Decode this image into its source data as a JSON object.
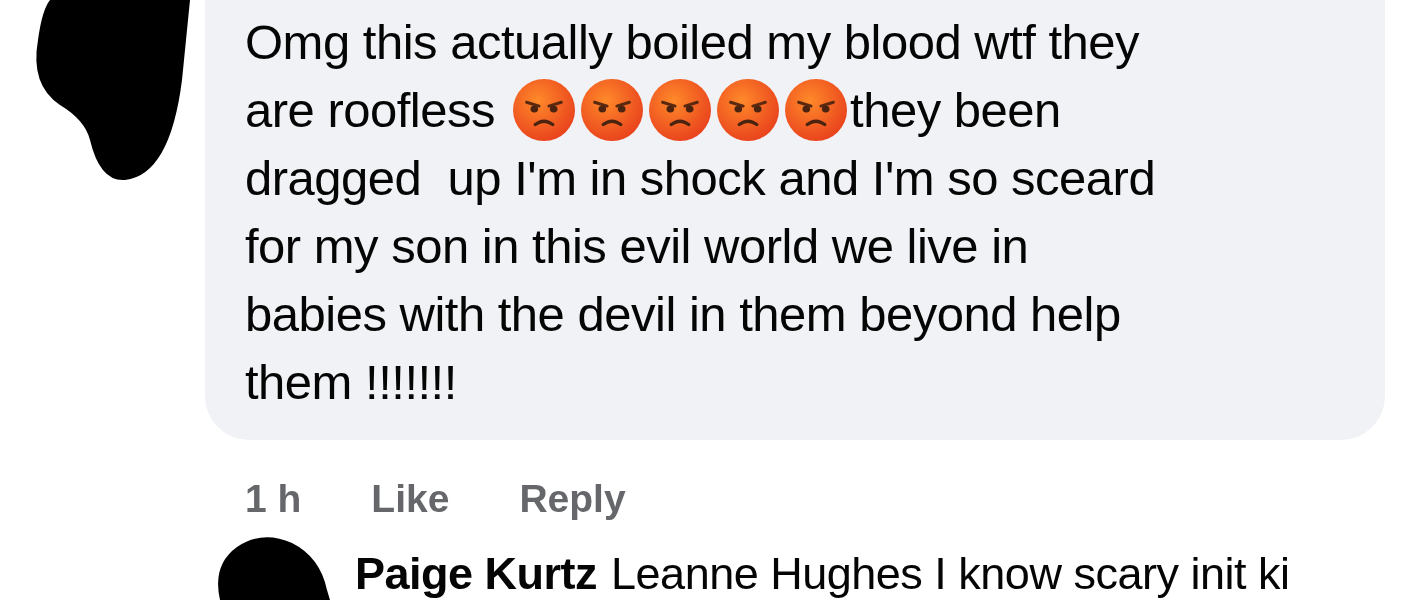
{
  "comment": {
    "lines": [
      {
        "parts": [
          {
            "kind": "text",
            "text": "Omg this actually boiled my blood wtf they"
          }
        ]
      },
      {
        "parts": [
          {
            "kind": "text",
            "text": "are roofless"
          },
          {
            "kind": "emoji"
          },
          {
            "kind": "emoji"
          },
          {
            "kind": "emoji"
          },
          {
            "kind": "emoji"
          },
          {
            "kind": "emoji"
          },
          {
            "kind": "text",
            "text": "they been"
          }
        ]
      },
      {
        "parts": [
          {
            "kind": "text",
            "text": "dragged  up I'm in shock and I'm so sceard"
          }
        ]
      },
      {
        "parts": [
          {
            "kind": "text",
            "text": "for my son in this evil world we live in"
          }
        ]
      },
      {
        "parts": [
          {
            "kind": "text",
            "text": "babies with the devil in them beyond help"
          }
        ]
      },
      {
        "parts": [
          {
            "kind": "text",
            "text": "them !!!!!!!"
          }
        ]
      }
    ],
    "time": "1 h",
    "actions": [
      "Like",
      "Reply"
    ]
  },
  "reply": {
    "author": "Paige Kurtz",
    "text": "Leanne Hughes I know scary init ki"
  }
}
